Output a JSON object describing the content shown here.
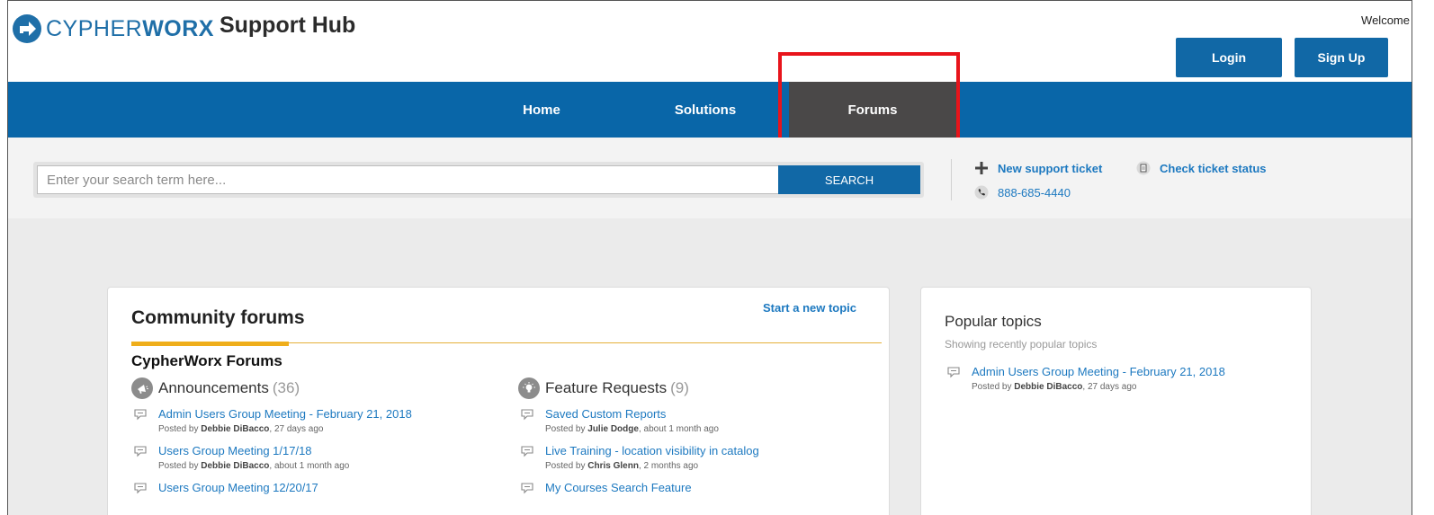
{
  "header": {
    "brand_word": "CYPHER",
    "brand_word_bold": "WORX",
    "brand_hub": "Support Hub",
    "welcome": "Welcome",
    "login_label": "Login",
    "signup_label": "Sign Up"
  },
  "nav": {
    "items": [
      {
        "label": "Home"
      },
      {
        "label": "Solutions"
      },
      {
        "label": "Forums",
        "active": true
      }
    ]
  },
  "search": {
    "placeholder": "Enter your search term here...",
    "button_label": "SEARCH"
  },
  "quick_links": {
    "new_ticket": "New support ticket",
    "check_status": "Check ticket status",
    "phone": "888-685-4440"
  },
  "forums_card": {
    "title": "Community forums",
    "new_topic": "Start a new topic",
    "category": "CypherWorx Forums",
    "columns": [
      {
        "name": "Announcements",
        "count": "(36)",
        "icon": "megaphone-icon",
        "topics": [
          {
            "title": "Admin Users Group Meeting - February 21, 2018",
            "posted_by": "Posted by",
            "author": "Debbie DiBacco",
            "when": ", 27 days ago"
          },
          {
            "title": "Users Group Meeting 1/17/18",
            "posted_by": "Posted by",
            "author": "Debbie DiBacco",
            "when": ", about 1 month ago"
          },
          {
            "title": "Users Group Meeting 12/20/17",
            "posted_by": "",
            "author": "",
            "when": ""
          }
        ]
      },
      {
        "name": "Feature Requests",
        "count": "(9)",
        "icon": "lightbulb-icon",
        "topics": [
          {
            "title": "Saved Custom Reports",
            "posted_by": "Posted by",
            "author": "Julie Dodge",
            "when": ", about 1 month ago"
          },
          {
            "title": "Live Training - location visibility in catalog",
            "posted_by": "Posted by",
            "author": "Chris Glenn",
            "when": ", 2 months ago"
          },
          {
            "title": "My Courses Search Feature",
            "posted_by": "",
            "author": "",
            "when": ""
          }
        ]
      }
    ]
  },
  "popular": {
    "title": "Popular topics",
    "subtitle": "Showing recently popular topics",
    "topics": [
      {
        "title": "Admin Users Group Meeting - February 21, 2018",
        "posted_by": "Posted by",
        "author": "Debbie DiBacco",
        "when": ", 27 days ago"
      }
    ]
  },
  "colors": {
    "brand_blue": "#0966a8",
    "link_blue": "#1d79c0",
    "nav_active": "#4a4848",
    "accent_yellow": "#efae1b",
    "highlight_red": "#e8141b"
  }
}
